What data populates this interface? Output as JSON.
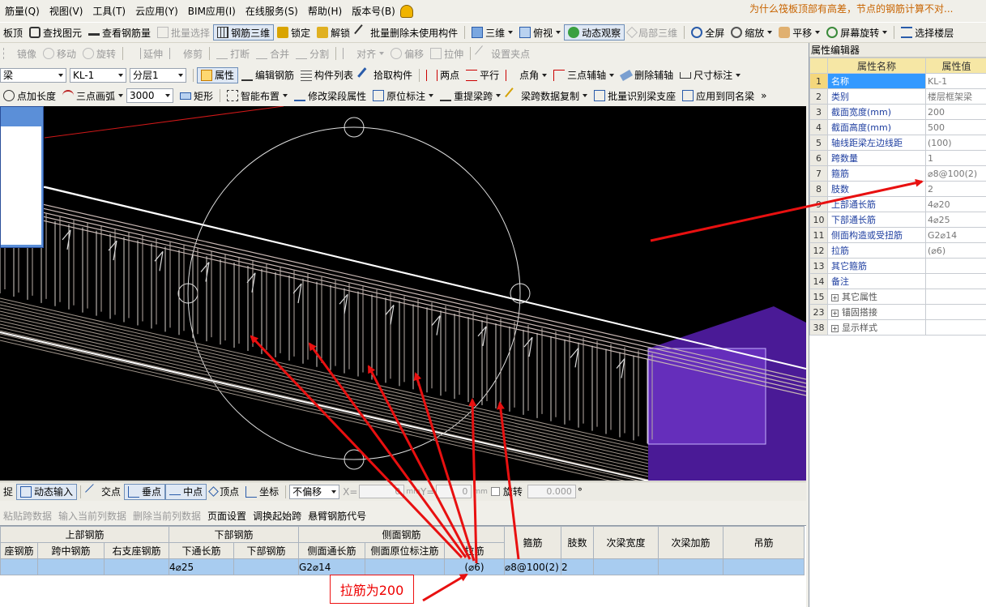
{
  "menubar": {
    "items": [
      "筋量(Q)",
      "视图(V)",
      "工具(T)",
      "云应用(Y)",
      "BIM应用(I)",
      "在线服务(S)",
      "帮助(H)",
      "版本号(B)"
    ],
    "warning": "为什么筏板顶部有高差，节点的钢筋计算不对..."
  },
  "toolbar1": {
    "items": [
      "板顶",
      "查找图元",
      "查看钢筋量",
      "批量选择",
      "钢筋三维",
      "锁定",
      "解锁",
      "批量删除未使用构件",
      "三维",
      "俯视",
      "动态观察",
      "局部三维",
      "全屏",
      "缩放",
      "平移",
      "屏幕旋转",
      "选择楼层"
    ]
  },
  "toolbar2": {
    "items": [
      "镜像",
      "移动",
      "旋转",
      "延伸",
      "修剪",
      "打断",
      "合并",
      "分割",
      "对齐",
      "偏移",
      "拉伸",
      "设置夹点"
    ]
  },
  "toolbar3": {
    "type_select": "梁",
    "name_select": "KL-1",
    "layer_select": "分层1",
    "items": [
      "属性",
      "编辑钢筋",
      "构件列表",
      "拾取构件",
      "两点",
      "平行",
      "点角",
      "三点辅轴",
      "删除辅轴",
      "尺寸标注"
    ]
  },
  "toolbar4": {
    "items": [
      "点加长度",
      "三点画弧"
    ],
    "length_value": "3000",
    "items2": [
      "矩形",
      "智能布置",
      "修改梁段属性",
      "原位标注",
      "重提梁跨",
      "梁跨数据复制",
      "批量识别梁支座",
      "应用到同名梁"
    ],
    "more": "»"
  },
  "snapbar": {
    "items": [
      "捉",
      "动态输入",
      "交点",
      "垂点",
      "中点",
      "顶点",
      "坐标"
    ],
    "offset_select": "不偏移",
    "x_label": "X=",
    "x_value": "0",
    "y_label": "Y=",
    "y_value": "0",
    "unit": "mm",
    "rotate_label": "旋转",
    "rotate_value": "0.000",
    "degree": "°"
  },
  "actionbar": {
    "items": [
      "粘贴跨数据",
      "输入当前列数据",
      "删除当前列数据",
      "页面设置",
      "调换起始跨",
      "悬臂钢筋代号"
    ]
  },
  "grid": {
    "group_headers": [
      "上部钢筋",
      "下部钢筋",
      "侧面钢筋",
      "箍筋",
      "肢数",
      "次梁宽度",
      "次梁加筋",
      "吊筋"
    ],
    "sub_headers": [
      "座钢筋",
      "跨中钢筋",
      "右支座钢筋",
      "下通长筋",
      "下部钢筋",
      "侧面通长筋",
      "侧面原位标注筋",
      "拉筋"
    ],
    "row": [
      "",
      "",
      "",
      "4⌀25",
      "",
      "G2⌀14",
      "",
      "(⌀6)",
      "⌀8@100(2)",
      "2",
      "",
      "",
      ""
    ]
  },
  "props": {
    "title": "属性编辑器",
    "col_name": "属性名称",
    "col_value": "属性值",
    "rows": [
      {
        "no": "1",
        "name": "名称",
        "value": "KL-1"
      },
      {
        "no": "2",
        "name": "类别",
        "value": "楼层框架梁"
      },
      {
        "no": "3",
        "name": "截面宽度(mm)",
        "value": "200"
      },
      {
        "no": "4",
        "name": "截面高度(mm)",
        "value": "500"
      },
      {
        "no": "5",
        "name": "轴线距梁左边线距",
        "value": "(100)"
      },
      {
        "no": "6",
        "name": "跨数量",
        "value": "1"
      },
      {
        "no": "7",
        "name": "箍筋",
        "value": "⌀8@100(2)"
      },
      {
        "no": "8",
        "name": "肢数",
        "value": "2"
      },
      {
        "no": "9",
        "name": "上部通长筋",
        "value": "4⌀20"
      },
      {
        "no": "10",
        "name": "下部通长筋",
        "value": "4⌀25"
      },
      {
        "no": "11",
        "name": "侧面构造或受扭筋",
        "value": "G2⌀14"
      },
      {
        "no": "12",
        "name": "拉筋",
        "value": "(⌀6)"
      },
      {
        "no": "13",
        "name": "其它箍筋",
        "value": ""
      },
      {
        "no": "14",
        "name": "备注",
        "value": ""
      },
      {
        "no": "15",
        "name": "其它属性",
        "value": ""
      },
      {
        "no": "23",
        "name": "锚固搭接",
        "value": ""
      },
      {
        "no": "38",
        "name": "显示样式",
        "value": ""
      }
    ]
  },
  "annotation": {
    "text": "拉筋为200",
    "color": "#e81010"
  }
}
